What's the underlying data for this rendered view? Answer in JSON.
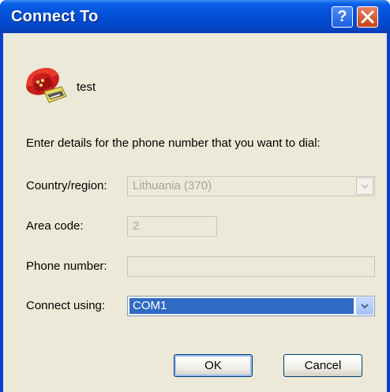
{
  "window": {
    "title": "Connect To",
    "help_button": "?",
    "connection_name": "test"
  },
  "form": {
    "prompt": "Enter details for the phone number that you want to dial:",
    "country_label": "Country/region:",
    "country_value": "Lithuania (370)",
    "area_label": "Area code:",
    "area_value": "2",
    "phone_label": "Phone number:",
    "phone_value": "",
    "connect_label": "Connect using:",
    "connect_value": "COM1"
  },
  "buttons": {
    "ok": "OK",
    "cancel": "Cancel"
  },
  "colors": {
    "titlebar": "#0350d8",
    "selection": "#316ac5",
    "face": "#ece9d8"
  }
}
